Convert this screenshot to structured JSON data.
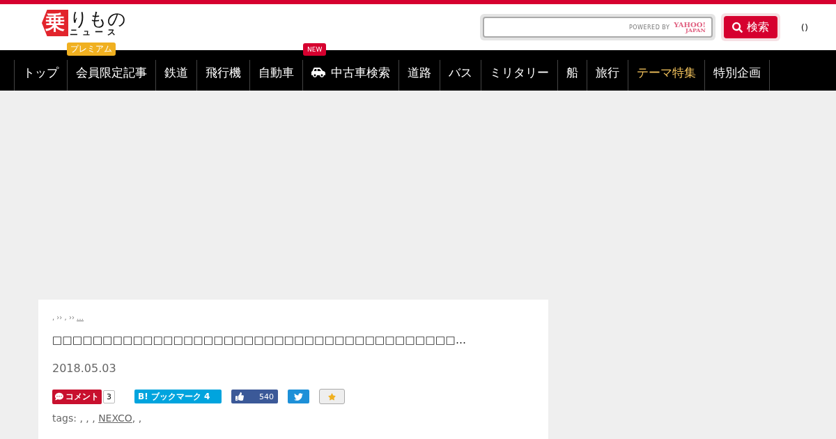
{
  "logo": {
    "mark": "乗",
    "name": "りもの",
    "sub": "ニュース",
    "badge": "プレミアム"
  },
  "search": {
    "powered_by": "POWERED BY",
    "provider": "YAHOO!",
    "provider_sub": "JAPAN",
    "button": "検索"
  },
  "header_link": "()",
  "nav": [
    {
      "label": "トップ",
      "kind": "plain",
      "highlighted": false
    },
    {
      "label": "会員限定記事",
      "kind": "plain",
      "highlighted": false
    },
    {
      "label": "鉄道",
      "kind": "plain",
      "highlighted": false
    },
    {
      "label": "飛行機",
      "kind": "plain",
      "highlighted": false
    },
    {
      "label": "自動車",
      "kind": "plain",
      "highlighted": false
    },
    {
      "label": "中古車検索",
      "kind": "car",
      "highlighted": false,
      "badge": "NEW"
    },
    {
      "label": "道路",
      "kind": "plain",
      "highlighted": false
    },
    {
      "label": "バス",
      "kind": "plain",
      "highlighted": false
    },
    {
      "label": "ミリタリー",
      "kind": "plain",
      "highlighted": false
    },
    {
      "label": "船",
      "kind": "plain",
      "highlighted": false
    },
    {
      "label": "旅行",
      "kind": "plain",
      "highlighted": false
    },
    {
      "label": "テーマ特集",
      "kind": "plain",
      "highlighted": true
    },
    {
      "label": "特別企画",
      "kind": "plain",
      "highlighted": false
    }
  ],
  "article": {
    "breadcrumb": ", ›› , ›› ",
    "breadcrumb_link": "…",
    "title": "□□□□□□□□□□□□□□□□□□□□□□□□□□□□□□□□□□□□□□□□…",
    "date": "2018.05.03",
    "comment": {
      "label": "コメント",
      "count": "3"
    },
    "bookmark": {
      "label": "B! ブックマーク",
      "count": "4"
    },
    "like": {
      "count": "540"
    },
    "tags": {
      "label": "tags:",
      "before": ", , ,",
      "link": "NEXCO",
      "after": ", ,"
    }
  }
}
